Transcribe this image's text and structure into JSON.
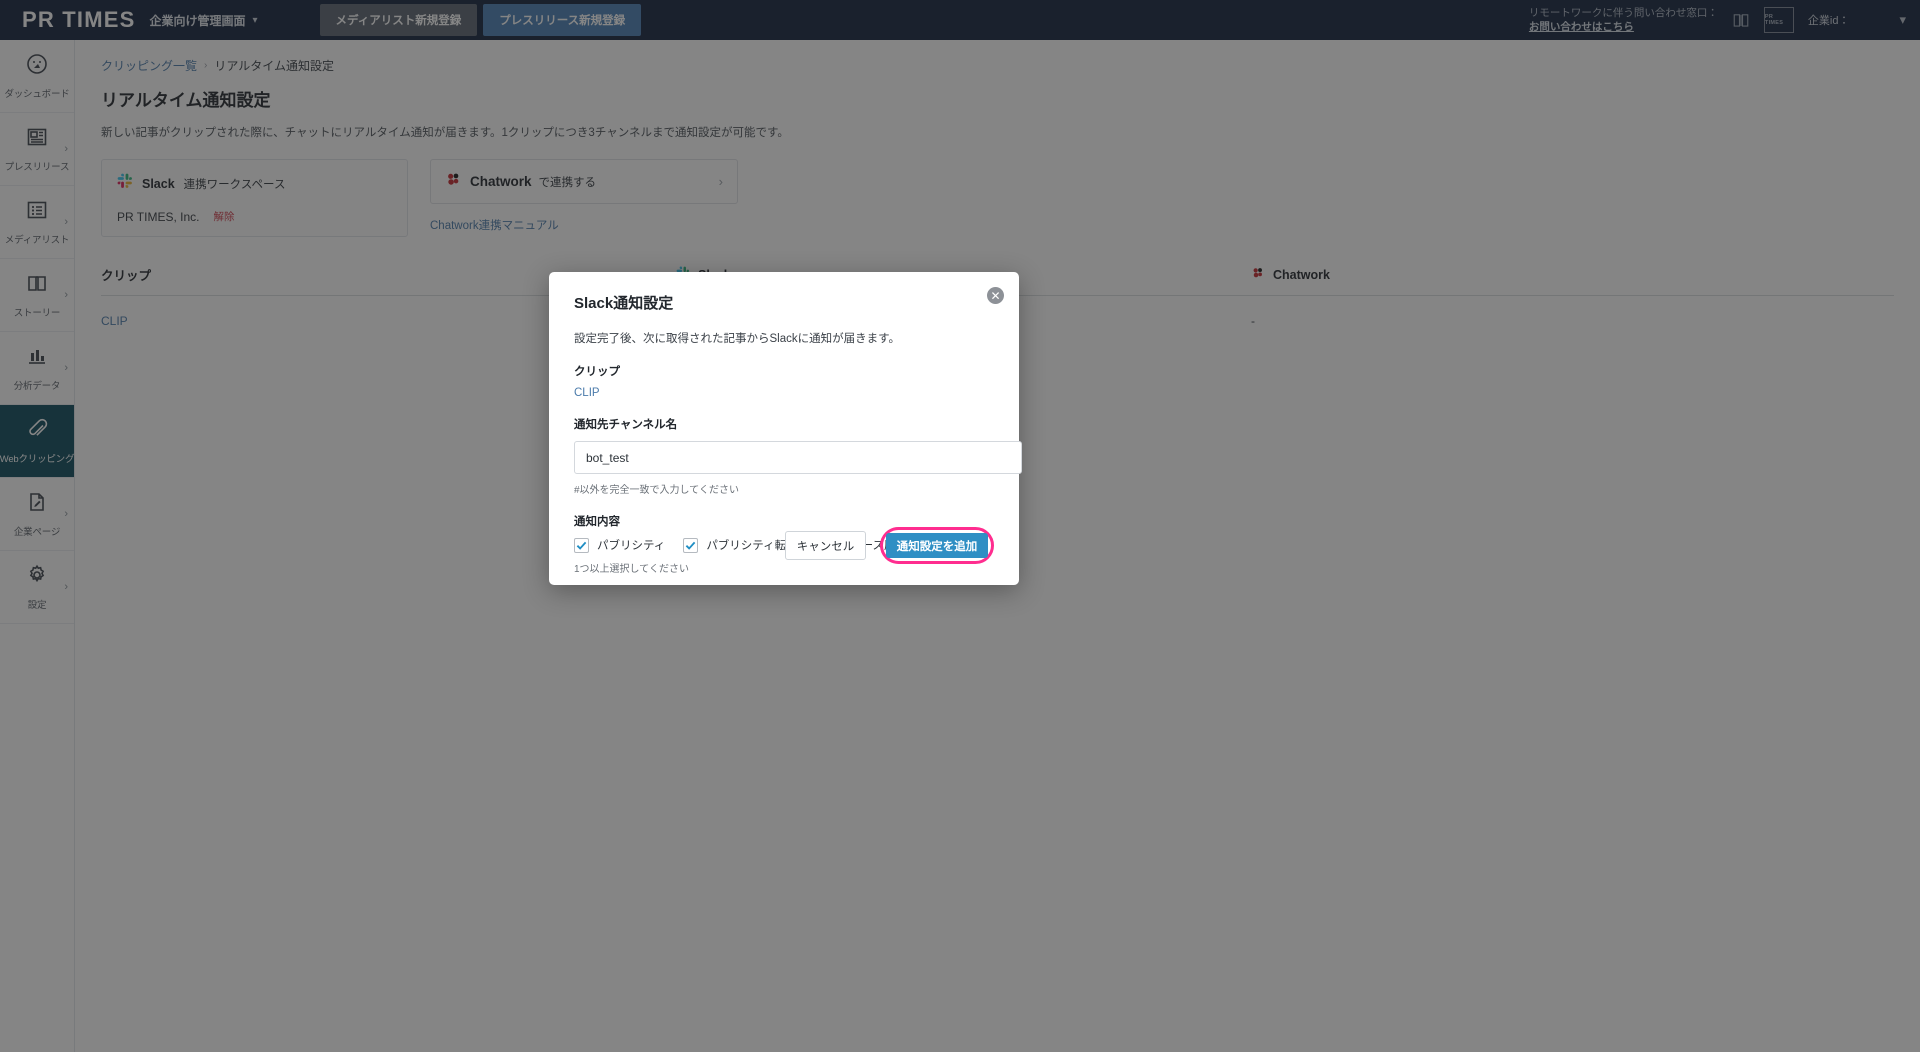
{
  "header": {
    "logo": "PR TIMES",
    "logo_sub": "企業向け管理画面",
    "caret_icon": "chevron-down-icon",
    "btn_media_list": "メディアリスト新規登録",
    "btn_new_release": "プレスリリース新規登録",
    "remote_line1": "リモートワークに伴う問い合わせ窓口：",
    "remote_line2": "お問い合わせはこちら",
    "mini_logo": "PR TIMES",
    "corp_id_label": "企業id：",
    "user_caret_icon": "chevron-down-icon"
  },
  "sidebar": {
    "items": [
      {
        "label": "ダッシュボード",
        "icon": "dashboard-icon",
        "has_chevron": false,
        "active": false
      },
      {
        "label": "プレスリリース",
        "icon": "press-release-icon",
        "has_chevron": true,
        "active": false
      },
      {
        "label": "メディアリスト",
        "icon": "media-list-icon",
        "has_chevron": true,
        "active": false
      },
      {
        "label": "ストーリー",
        "icon": "book-icon",
        "has_chevron": true,
        "active": false
      },
      {
        "label": "分析データ",
        "icon": "bar-chart-icon",
        "has_chevron": true,
        "active": false
      },
      {
        "label": "Webクリッピング",
        "icon": "paperclip-icon",
        "has_chevron": false,
        "active": true
      },
      {
        "label": "企業ページ",
        "icon": "page-edit-icon",
        "has_chevron": true,
        "active": false
      },
      {
        "label": "設定",
        "icon": "gear-icon",
        "has_chevron": true,
        "active": false
      }
    ]
  },
  "breadcrumb": {
    "parent": "クリッピング一覧",
    "separator": "›",
    "current": "リアルタイム通知設定"
  },
  "page": {
    "title": "リアルタイム通知設定",
    "description": "新しい記事がクリップされた際に、チャットにリアルタイム通知が届きます。1クリップにつき3チャンネルまで通知設定が可能です。"
  },
  "slack_card": {
    "service_name": "Slack",
    "heading_sub": "連携ワークスペース",
    "workspace": "PR TIMES, Inc.",
    "unlink_label": "解除",
    "icon": "slack-icon"
  },
  "chatwork_card": {
    "service_name": "Chatwork",
    "sub": "で連携する",
    "chevron_icon": "chevron-right-icon",
    "manual_link": "Chatwork連携マニュアル",
    "icon": "chatwork-icon"
  },
  "table": {
    "columns": [
      "クリップ",
      "Slack",
      "Chatwork"
    ],
    "slack_icon": "slack-icon",
    "chatwork_icon": "chatwork-icon",
    "rows": [
      {
        "clip": "CLIP",
        "slack": "",
        "chatwork": "-"
      }
    ]
  },
  "modal": {
    "title": "Slack通知設定",
    "close_icon": "close-icon",
    "description": "設定完了後、次に取得された記事からSlackに通知が届きます。",
    "clip_label": "クリップ",
    "clip_value": "CLIP",
    "channel_label": "通知先チャンネル名",
    "channel_value": "bot_test",
    "channel_placeholder": "",
    "channel_hint": "#以外を完全一致で入力してください",
    "content_label": "通知内容",
    "checkboxes": [
      {
        "label": "パブリシティ",
        "checked": true
      },
      {
        "label": "パブリシティ転載",
        "checked": true
      },
      {
        "label": "リリース原文転載",
        "checked": true
      }
    ],
    "checkbox_hint": "1つ以上選択してください",
    "cancel_label": "キャンセル",
    "submit_label": "通知設定を追加"
  },
  "colors": {
    "header_bg": "#13233d",
    "sidebar_active": "#0d4a5c",
    "link_blue": "#4b7bab",
    "submit_blue": "#2f8fc4",
    "highlight_pink": "#ff2d8f",
    "danger_red": "#cf3b4a",
    "checkbox_blue": "#1f8ec4"
  }
}
